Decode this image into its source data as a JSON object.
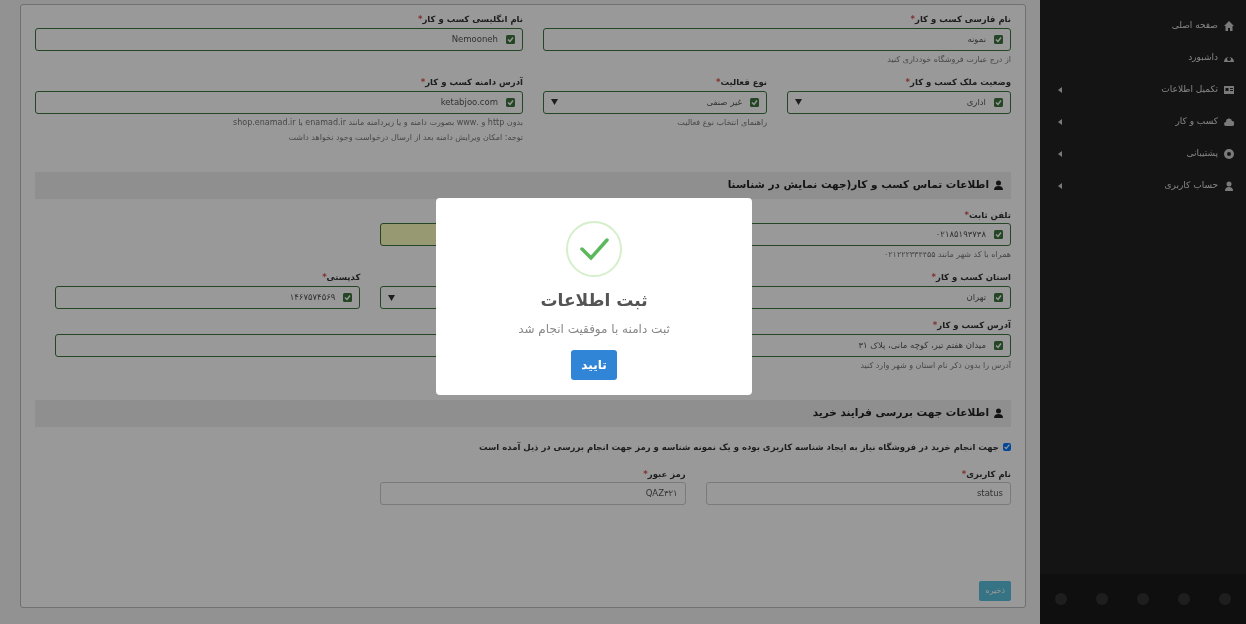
{
  "sidebar": {
    "items": [
      {
        "label": "صفحه اصلی",
        "has_submenu": false
      },
      {
        "label": "داشبورد",
        "has_submenu": false
      },
      {
        "label": "تکمیل اطلاعات",
        "has_submenu": true
      },
      {
        "label": "کسب و کار",
        "has_submenu": true
      },
      {
        "label": "پشتیبانی",
        "has_submenu": true
      },
      {
        "label": "حساب کاربری",
        "has_submenu": true
      }
    ]
  },
  "form": {
    "sections": [
      {
        "rows": [
          {
            "fields": [
              {
                "kind": "input",
                "label": "نام فارسی کسب و کار",
                "required_mark": "*",
                "value": "نمونه",
                "valid": true,
                "autofilled": false,
                "hints": [
                  "از درج عبارت فروشگاه خودداری کنید"
                ]
              },
              {
                "kind": "input",
                "label": "نام انگلیسی کسب و کار",
                "required_mark": "*",
                "value": "Nemooneh",
                "valid": true,
                "autofilled": false
              }
            ]
          },
          {
            "fields": [
              {
                "kind": "select",
                "label": "وضعیت ملک کسب و کار",
                "required_mark": "*",
                "value": "اداری",
                "valid": true,
                "autofilled": false
              },
              {
                "kind": "select",
                "label": "نوع فعالیت",
                "required_mark": "*",
                "value": "غیر صنفی",
                "valid": true,
                "autofilled": false,
                "hints": [
                  "راهنمای انتخاب نوع فعالیت"
                ]
              },
              {
                "kind": "input",
                "label": "آدرس دامنه کسب و کار",
                "required_mark": "*",
                "value": "ketabjoo.com",
                "valid": true,
                "autofilled": false,
                "hints": [
                  "بدون http و .www بصورت دامنه و یا زیردامنه مانند enamad.ir یا shop.enamad.ir",
                  "توجه: امکان ویرایش دامنه بعد از ارسال درخواست وجود نخواهد داشت"
                ]
              }
            ]
          }
        ]
      },
      {
        "title": "اطلاعات تماس کسب و کار(جهت نمایش در شناسنا",
        "rows": [
          {
            "fields": [
              {
                "kind": "input",
                "label": "تلفن ثابت",
                "required_mark": "*",
                "value": "۰۲۱۸۵۱۹۳۷۳۸",
                "valid": true,
                "autofilled": false,
                "hints": [
                  "همراه با کد شهر مانند ۰۲۱۲۲۲۳۳۴۴۵۵"
                ]
              },
              {
                "kind": "input",
                "valid": false,
                "autofilled": true
              }
            ]
          },
          {
            "fields": [
              {
                "kind": "input",
                "label": "استان کسب و کار",
                "required_mark": "*",
                "value": "تهران",
                "valid": true,
                "autofilled": false
              },
              {
                "kind": "select",
                "autofilled": false
              },
              {
                "kind": "input",
                "label": "کدپستی",
                "required_mark": "*",
                "value": "۱۴۶۷۵۷۴۵۶۹",
                "valid": true,
                "autofilled": false
              }
            ]
          },
          {
            "fields": [
              {
                "kind": "input",
                "label": "آدرس کسب و کار",
                "required_mark": "*",
                "value": "میدان هفتم تیر، کوچه مانی، پلاک ۳۱",
                "valid": true,
                "autofilled": false,
                "hints": [
                  "آدرس را بدون ذکر نام استان و شهر وارد کنید"
                ]
              }
            ]
          }
        ]
      },
      {
        "title": "اطلاعات جهت بررسی فرایند خرید",
        "note": {
          "checked": true,
          "text": "جهت انجام خرید در فروشگاه نیاز به ایجاد شناسه کاربری بوده و یک نمونه شناسه و رمز جهت انجام بررسی در ذیل آمده است"
        },
        "rows": [
          {
            "fields": [
              {
                "kind": "input",
                "label": "نام کاربری",
                "required_mark": "*",
                "value": "status",
                "valid": false,
                "autofilled": false
              },
              {
                "kind": "input",
                "label": "رمز عبور",
                "required_mark": "*",
                "value": "QAZ۳۲۱",
                "valid": false,
                "autofilled": false
              }
            ]
          }
        ]
      }
    ],
    "save_button": "ذخیره"
  },
  "dialog": {
    "title": "ثبت اطلاعات",
    "message": "ثبت دامنه با موفقیت انجام شد",
    "confirm_button": "تایید"
  }
}
